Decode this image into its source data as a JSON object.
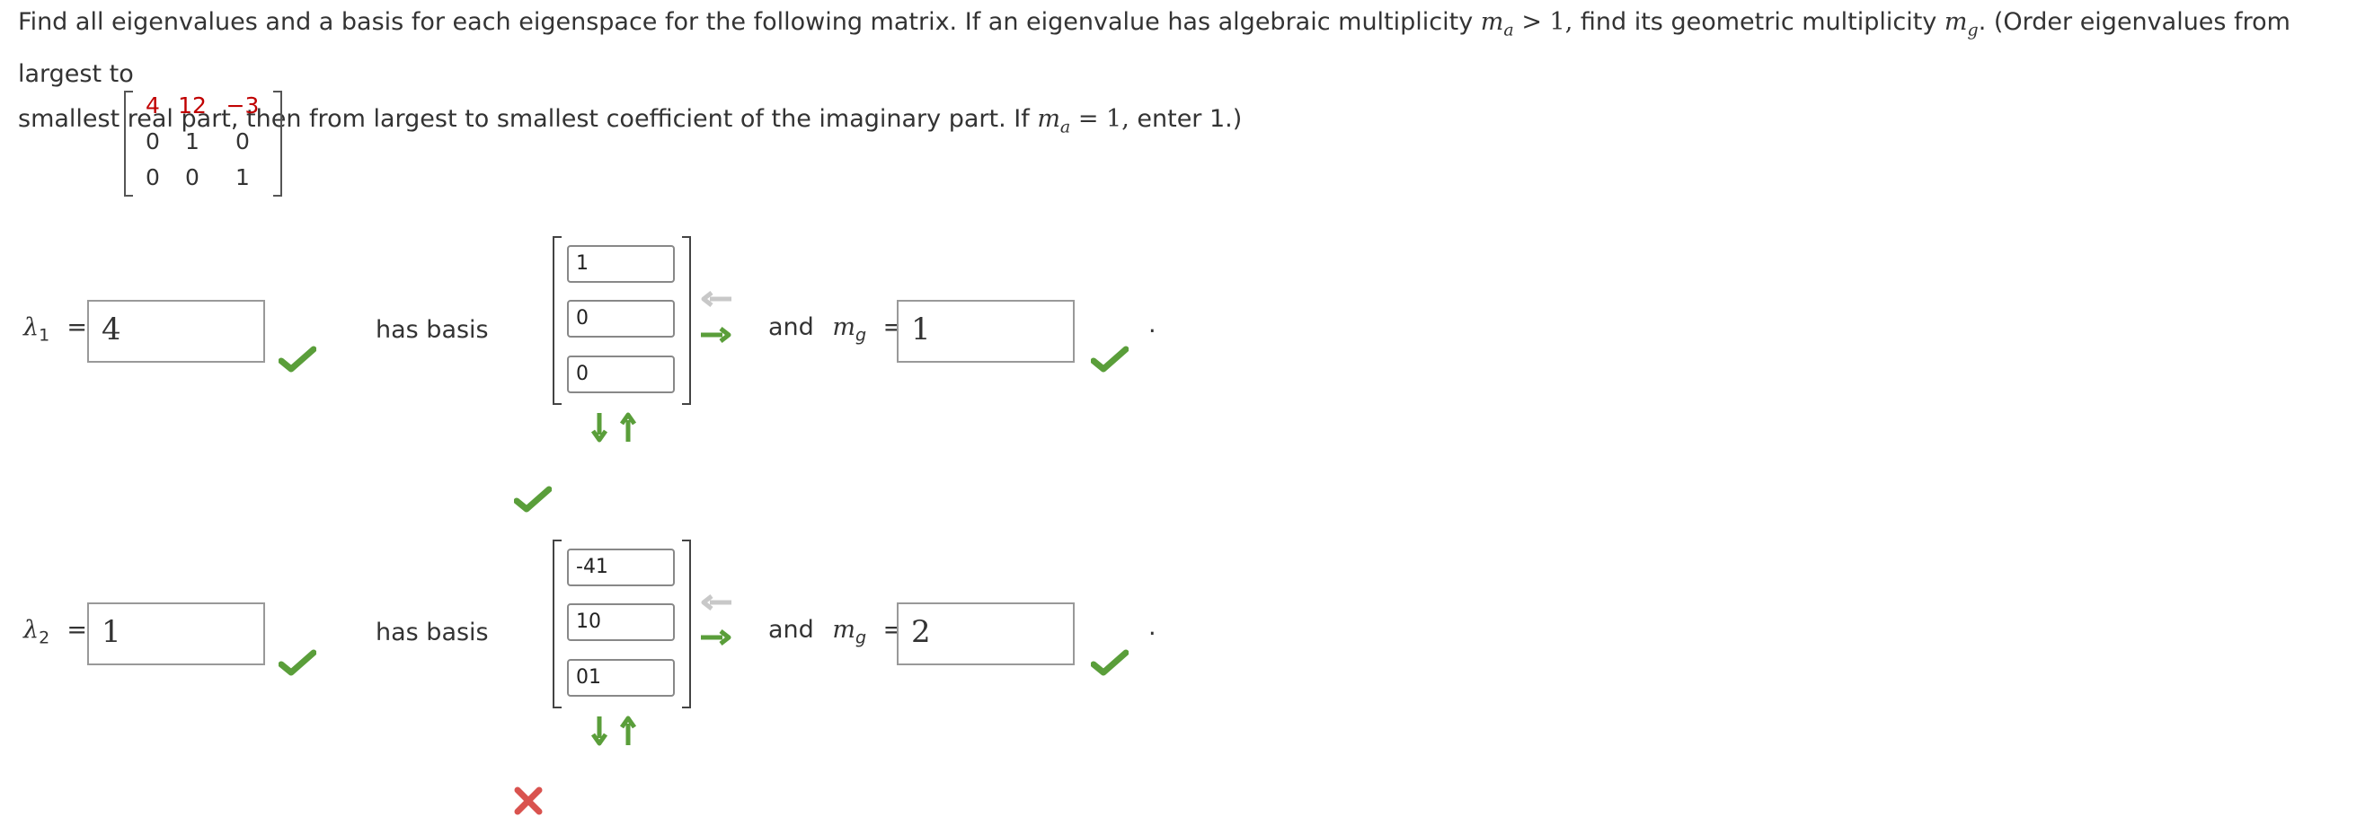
{
  "prompt": {
    "line1_a": "Find all eigenvalues and a basis for each eigenspace for the following matrix. If an eigenvalue has algebraic multiplicity",
    "ma_sym": "m",
    "ma_sub": "a",
    "gt_one": " > 1, ",
    "line1_b": "find its geometric multiplicity",
    "mg_sym": "m",
    "mg_sub": "g",
    "line1_c": ". (Order eigenvalues from largest to",
    "line2_a": "smallest real part, then from largest to smallest coefficient of the imaginary part. If",
    "eq_one": " = 1, ",
    "line2_b": "enter 1.)"
  },
  "matrix": {
    "rows": [
      [
        "4",
        "12",
        "−3"
      ],
      [
        "0",
        "1",
        "0"
      ],
      [
        "0",
        "0",
        "1"
      ]
    ]
  },
  "eigen": [
    {
      "lambda_symbol": "λ",
      "lambda_index": "1",
      "equals": "=",
      "lambda_value": "4",
      "has_basis": "has basis",
      "basis": [
        "1",
        "0",
        "0"
      ],
      "and_text": "and",
      "mg_symbol": "m",
      "mg_index": "g",
      "mg_value": "1",
      "period": ".",
      "basis_status": "correct"
    },
    {
      "lambda_symbol": "λ",
      "lambda_index": "2",
      "equals": "=",
      "lambda_value": "1",
      "has_basis": "has basis",
      "basis": [
        "-41",
        "10",
        "01"
      ],
      "and_text": "and",
      "mg_symbol": "m",
      "mg_index": "g",
      "mg_value": "2",
      "period": ".",
      "basis_status": "incorrect"
    }
  ],
  "icons": {
    "correct": "check-icon",
    "incorrect": "x-icon",
    "add_vector": "arrow-right-icon",
    "remove_vector": "arrow-left-icon",
    "add_row": "arrow-down-icon",
    "remove_row": "arrow-up-icon"
  },
  "colors": {
    "check": "#5a9e3a",
    "cross": "#d9534f",
    "matrix_red": "#c00000"
  }
}
